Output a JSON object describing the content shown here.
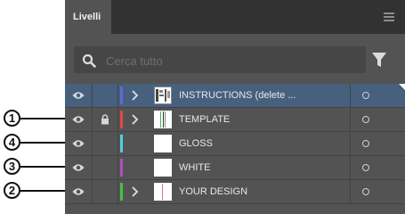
{
  "panel": {
    "tab_label": "Livelli",
    "search_placeholder": "Cerca tutto"
  },
  "layers": [
    {
      "name": "INSTRUCTIONS (delete ...",
      "color": "#5f6bd6",
      "selected": true,
      "has_chevron": true,
      "locked": false,
      "thumbnail": "instructions-thumbnail"
    },
    {
      "name": "TEMPLATE",
      "color": "#e04646",
      "selected": false,
      "has_chevron": true,
      "locked": true,
      "thumbnail": "template-thumbnail"
    },
    {
      "name": "GLOSS",
      "color": "#4fd1d8",
      "selected": false,
      "has_chevron": false,
      "locked": false,
      "thumbnail": "blank-thumbnail"
    },
    {
      "name": "WHITE",
      "color": "#b04fb8",
      "selected": false,
      "has_chevron": false,
      "locked": false,
      "thumbnail": "blank-thumbnail"
    },
    {
      "name": "YOUR DESIGN",
      "color": "#45c245",
      "selected": false,
      "has_chevron": true,
      "locked": false,
      "thumbnail": "design-thumbnail"
    }
  ],
  "callouts": [
    "1",
    "4",
    "3",
    "2"
  ]
}
